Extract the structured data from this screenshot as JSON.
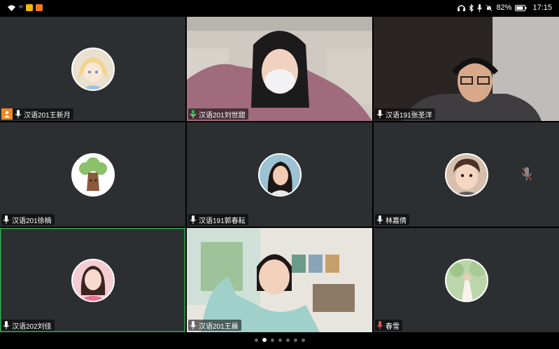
{
  "status_bar": {
    "battery_percent": "82%",
    "time": "17:15",
    "icons": [
      "wifi-icon",
      "hd-badge-icon",
      "app-badge-yellow-icon",
      "app-badge-orange-icon",
      "headphones-icon",
      "bluetooth-icon",
      "mic-icon",
      "mute-bell-icon",
      "battery-icon"
    ]
  },
  "participants": [
    {
      "name": "汉语201王新月",
      "mode": "avatar",
      "mic": "active",
      "host": true,
      "speaking": false
    },
    {
      "name": "汉语201刘世甜",
      "mode": "video",
      "mic": "active",
      "host": false,
      "speaking": false
    },
    {
      "name": "汉语191张圣洋",
      "mode": "video",
      "mic": "active",
      "host": false,
      "speaking": false
    },
    {
      "name": "汉语201徐楠",
      "mode": "avatar",
      "mic": "active",
      "host": false,
      "speaking": false
    },
    {
      "name": "汉语191郭春耘",
      "mode": "avatar",
      "mic": "active",
      "host": false,
      "speaking": false
    },
    {
      "name": "林嘉倩",
      "mode": "avatar",
      "mic": "active",
      "host": false,
      "speaking": false,
      "muted_indicator": true
    },
    {
      "name": "汉语202刘佳",
      "mode": "avatar",
      "mic": "active",
      "host": false,
      "speaking": true
    },
    {
      "name": "汉语201王晨",
      "mode": "video",
      "mic": "active",
      "host": false,
      "speaking": false
    },
    {
      "name": "春雪",
      "mode": "avatar",
      "mic": "muted",
      "host": false,
      "speaking": false
    }
  ],
  "pager": {
    "total": 7,
    "current": 2
  },
  "colors": {
    "speaking_border": "#2fa84f",
    "host": "#f08a1d",
    "mic_active": "#2fa84f",
    "mic_muted": "#e05a5a",
    "tile_bg": "#2c2f31"
  }
}
